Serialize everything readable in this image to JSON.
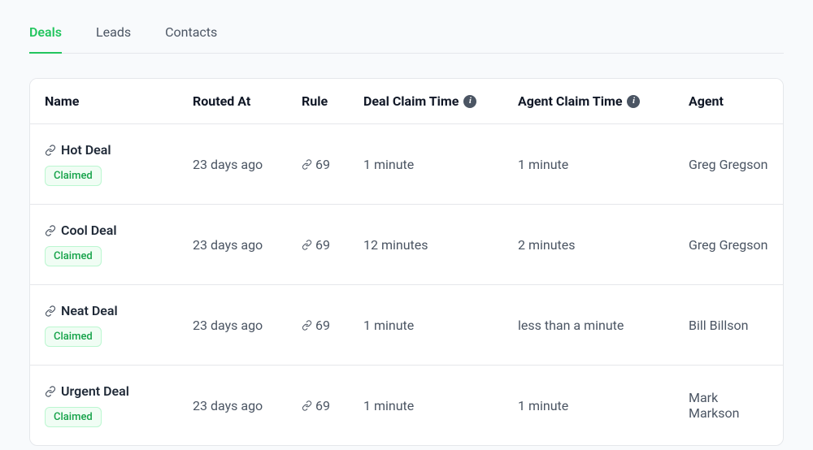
{
  "tabs": [
    {
      "label": "Deals",
      "active": true
    },
    {
      "label": "Leads",
      "active": false
    },
    {
      "label": "Contacts",
      "active": false
    }
  ],
  "headers": {
    "name": "Name",
    "routed_at": "Routed At",
    "rule": "Rule",
    "deal_claim_time": "Deal Claim Time",
    "agent_claim_time": "Agent Claim Time",
    "agent": "Agent"
  },
  "badge_label": "Claimed",
  "rows": [
    {
      "name": "Hot Deal",
      "routed_at": "23 days ago",
      "rule": "69",
      "deal_claim_time": "1 minute",
      "agent_claim_time": "1 minute",
      "agent": "Greg Gregson"
    },
    {
      "name": "Cool Deal",
      "routed_at": "23 days ago",
      "rule": "69",
      "deal_claim_time": "12 minutes",
      "agent_claim_time": "2 minutes",
      "agent": "Greg Gregson"
    },
    {
      "name": "Neat Deal",
      "routed_at": "23 days ago",
      "rule": "69",
      "deal_claim_time": "1 minute",
      "agent_claim_time": "less than a minute",
      "agent": "Bill Billson"
    },
    {
      "name": "Urgent Deal",
      "routed_at": "23 days ago",
      "rule": "69",
      "deal_claim_time": "1 minute",
      "agent_claim_time": "1 minute",
      "agent": "Mark Markson"
    }
  ]
}
